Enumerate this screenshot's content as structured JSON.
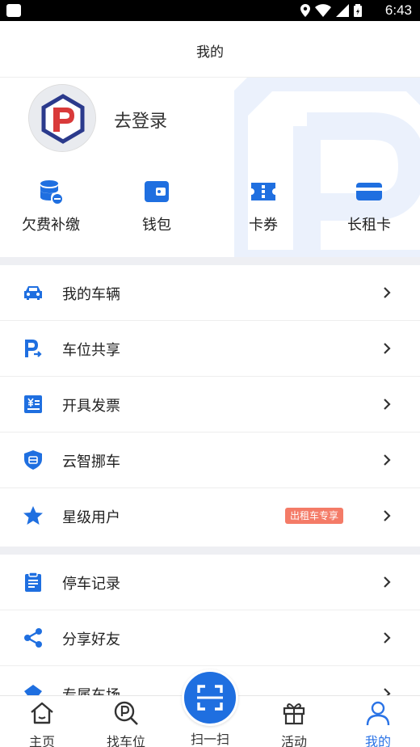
{
  "status_bar": {
    "time": "6:43"
  },
  "header": {
    "title": "我的"
  },
  "profile": {
    "login_label": "去登录"
  },
  "quick_actions": [
    {
      "label": "欠费补缴",
      "icon": "database-icon"
    },
    {
      "label": "钱包",
      "icon": "wallet-icon"
    },
    {
      "label": "卡券",
      "icon": "ticket-icon"
    },
    {
      "label": "长租卡",
      "icon": "card-icon"
    }
  ],
  "menu_group1": [
    {
      "label": "我的车辆",
      "icon": "car-icon"
    },
    {
      "label": "车位共享",
      "icon": "parking-share-icon"
    },
    {
      "label": "开具发票",
      "icon": "invoice-icon"
    },
    {
      "label": "云智挪车",
      "icon": "shield-icon"
    },
    {
      "label": "星级用户",
      "icon": "star-icon",
      "badge": "出租车专享"
    }
  ],
  "menu_group2": [
    {
      "label": "停车记录",
      "icon": "clipboard-icon"
    },
    {
      "label": "分享好友",
      "icon": "share-icon"
    },
    {
      "label": "专属车场",
      "icon": "gift-box-icon"
    }
  ],
  "tabbar": {
    "tabs": [
      {
        "label": "主页",
        "icon": "home-icon"
      },
      {
        "label": "找车位",
        "icon": "search-parking-icon"
      },
      {
        "label": "扫一扫",
        "icon": "scan-icon"
      },
      {
        "label": "活动",
        "icon": "gift-icon"
      },
      {
        "label": "我的",
        "icon": "user-icon"
      }
    ],
    "active_index": 4
  },
  "colors": {
    "accent": "#2a73e6",
    "badge": "#f47b67",
    "separator": "#eeeff3"
  }
}
